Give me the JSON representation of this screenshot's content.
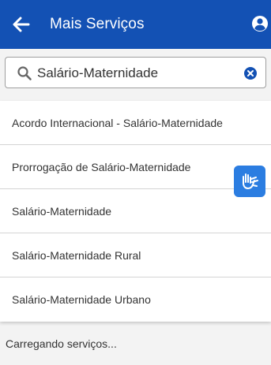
{
  "header": {
    "title": "Mais Serviços",
    "back_icon": "arrow-left-icon",
    "profile_icon": "user-circle-icon"
  },
  "search": {
    "value": "Salário-Maternidade",
    "search_icon": "search-icon",
    "clear_icon": "clear-icon"
  },
  "results": [
    {
      "label": "Acordo Internacional - Salário-Maternidade"
    },
    {
      "label": "Prorrogação de Salário-Maternidade"
    },
    {
      "label": "Salário-Maternidade"
    },
    {
      "label": "Salário-Maternidade Rural"
    },
    {
      "label": "Salário-Maternidade Urbano"
    }
  ],
  "accessibility": {
    "icon": "sign-language-icon"
  },
  "status": {
    "loading_text": "Carregando serviços..."
  },
  "colors": {
    "header_bg": "#1351b4",
    "libras_bg": "#2b7de1",
    "text": "#333333",
    "divider": "#d4d4d4",
    "page_bg": "#f3f3f3"
  }
}
